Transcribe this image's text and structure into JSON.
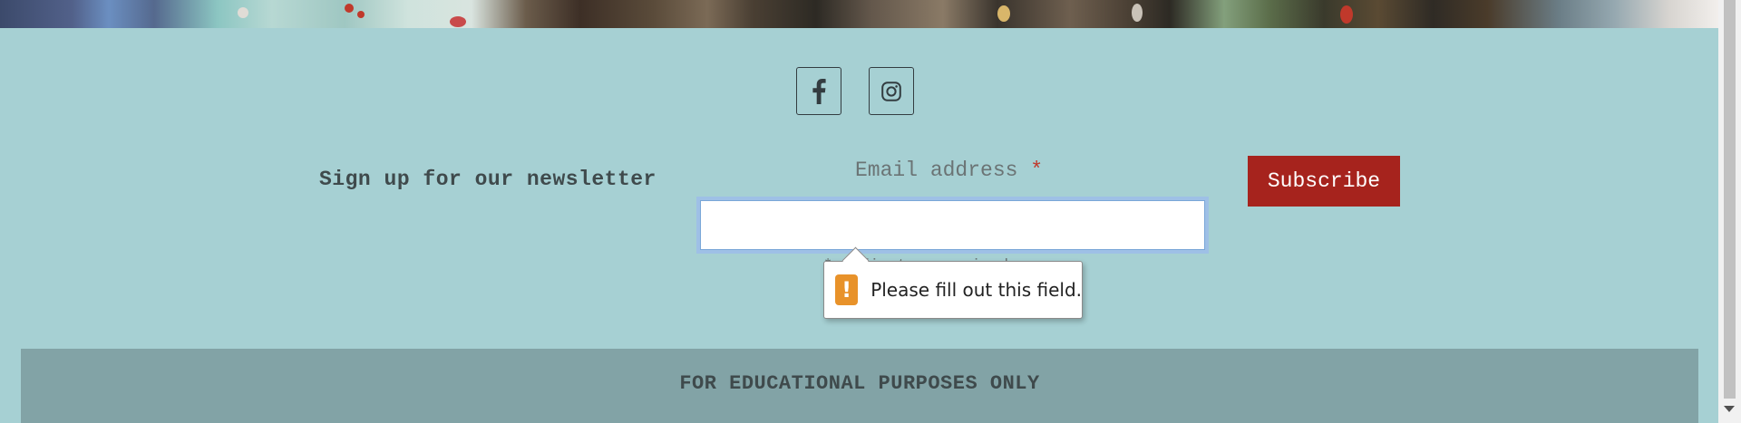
{
  "social": {
    "facebook_icon": "facebook-icon",
    "instagram_icon": "instagram-icon"
  },
  "newsletter": {
    "heading": "Sign up for our newsletter",
    "email_label": "Email address",
    "required_marker": "*",
    "email_value": "",
    "hint": "* indicates required",
    "subscribe_label": "Subscribe"
  },
  "validation": {
    "icon": "warning-icon",
    "icon_glyph": "!",
    "message": "Please fill out this field."
  },
  "footer": {
    "text": "FOR EDUCATIONAL PURPOSES ONLY"
  },
  "colors": {
    "background": "#a6d0d3",
    "button": "#a6231d",
    "footer": "#82a3a6",
    "warning": "#e8922a"
  }
}
